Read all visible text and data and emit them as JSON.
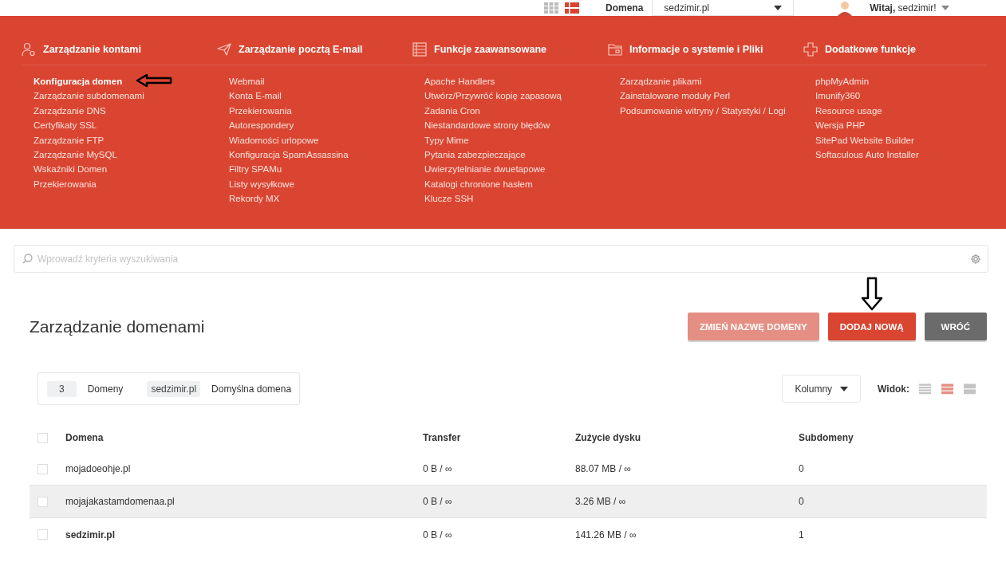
{
  "top_bar": {
    "layout_toggle": [
      {
        "selected": false
      },
      {
        "selected": true
      }
    ],
    "domain_label": "Domena",
    "domain_select": {
      "value": "sedzimir.pl"
    },
    "greeting": {
      "prefix": "Witaj,",
      "user": "sedzimir!"
    }
  },
  "menu": {
    "sections": [
      {
        "kind": "accounts",
        "title": "Zarządzanie kontami",
        "items": [
          {
            "label": "Konfiguracja domen",
            "selected": true
          },
          {
            "label": "Zarządzanie subdomenami",
            "selected": false
          },
          {
            "label": "Zarządzanie DNS",
            "selected": false
          },
          {
            "label": "Certyfikaty SSL",
            "selected": false
          },
          {
            "label": "Zarządzanie FTP",
            "selected": false
          },
          {
            "label": "Zarządzanie MySQL",
            "selected": false
          },
          {
            "label": "Wskaźniki Domen",
            "selected": false
          },
          {
            "label": "Przekierowania",
            "selected": false
          }
        ]
      },
      {
        "kind": "mail",
        "title": "Zarządzanie pocztą E-mail",
        "items": [
          {
            "label": "Webmail",
            "selected": false
          },
          {
            "label": "Konta E-mail",
            "selected": false
          },
          {
            "label": "Przekierowania",
            "selected": false
          },
          {
            "label": "Autorespondery",
            "selected": false
          },
          {
            "label": "Wiadomości urlopowe",
            "selected": false
          },
          {
            "label": "Konfiguracja SpamAssassina",
            "selected": false
          },
          {
            "label": "Filtry SPAMu",
            "selected": false
          },
          {
            "label": "Listy wysyłkowe",
            "selected": false
          },
          {
            "label": "Rekordy MX",
            "selected": false
          }
        ]
      },
      {
        "kind": "advanced",
        "title": "Funkcje zaawansowane",
        "items": [
          {
            "label": "Apache Handlers",
            "selected": false
          },
          {
            "label": "Utwórz/Przywróć kopię zapasową",
            "selected": false
          },
          {
            "label": "Zadania Cron",
            "selected": false
          },
          {
            "label": "Niestandardowe strony błędów",
            "selected": false
          },
          {
            "label": "Typy Mime",
            "selected": false
          },
          {
            "label": "Pytania zabezpieczające",
            "selected": false
          },
          {
            "label": "Uwierzytelnianie dwuetapowe",
            "selected": false
          },
          {
            "label": "Katalogi chronione hasłem",
            "selected": false
          },
          {
            "label": "Klucze SSH",
            "selected": false
          }
        ]
      },
      {
        "kind": "system",
        "title": "Informacje o systemie i Pliki",
        "items": [
          {
            "label": "Zarządzanie plikami",
            "selected": false
          },
          {
            "label": "Zainstalowane moduły Perl",
            "selected": false
          },
          {
            "label": "Podsumowanie witryny / Statystyki / Logi",
            "selected": false
          }
        ]
      },
      {
        "kind": "extra",
        "title": "Dodatkowe funkcje",
        "items": [
          {
            "label": "phpMyAdmin",
            "selected": false
          },
          {
            "label": "Imunify360",
            "selected": false
          },
          {
            "label": "Resource usage",
            "selected": false
          },
          {
            "label": "Wersja PHP",
            "selected": false
          },
          {
            "label": "SitePad Website Builder",
            "selected": false
          },
          {
            "label": "Softaculous Auto Installer",
            "selected": false
          }
        ]
      }
    ]
  },
  "search": {
    "placeholder": "Wprowadź kryteria wyszukiwania"
  },
  "page_title": "Zarządzanie domenami",
  "actions": [
    {
      "label": "ZMIEŃ NAZWĘ DOMENY",
      "kind": "primary",
      "disabled": true
    },
    {
      "label": "DODAJ NOWĄ",
      "kind": "primary",
      "disabled": false
    },
    {
      "label": "WRÓĆ",
      "kind": "secondary",
      "disabled": false
    }
  ],
  "summary": [
    {
      "value": "3",
      "label": "Domeny"
    },
    {
      "value": "sedzimir.pl",
      "label": "Domyślna domena"
    }
  ],
  "columns_button": "Kolumny",
  "view_label": "Widok:",
  "view_modes": [
    {
      "selected": false
    },
    {
      "selected": true
    },
    {
      "selected": false
    }
  ],
  "table": {
    "header_checked": false,
    "columns": [
      "Domena",
      "Transfer",
      "Zużycie dysku",
      "Subdomeny"
    ],
    "rows": [
      {
        "checked": false,
        "highlighted": false,
        "default": false,
        "cells": [
          "mojadoeohje.pl",
          "0 B / ∞",
          "88.07 MB / ∞",
          "0"
        ]
      },
      {
        "checked": false,
        "highlighted": true,
        "default": false,
        "cells": [
          "mojajakastamdomenaa.pl",
          "0 B / ∞",
          "3.26 MB / ∞",
          "0"
        ]
      },
      {
        "checked": false,
        "highlighted": false,
        "default": true,
        "cells": [
          "sedzimir.pl",
          "0 B / ∞",
          "141.26 MB / ∞",
          "1"
        ]
      }
    ]
  }
}
